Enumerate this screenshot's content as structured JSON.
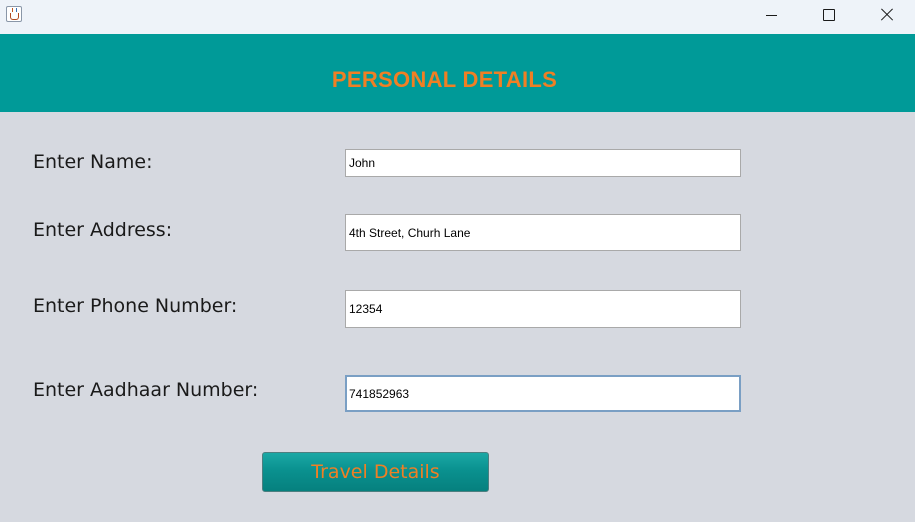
{
  "window": {
    "icon": "java-cup-icon"
  },
  "header": {
    "title": "PERSONAL DETAILS"
  },
  "form": {
    "name_label": "Enter Name:",
    "name_value": "John",
    "address_label": "Enter Address:",
    "address_value": "4th Street, Churh Lane",
    "phone_label": "Enter Phone Number:",
    "phone_value": "12354",
    "aadhaar_label": "Enter Aadhaar Number:",
    "aadhaar_value": "741852963"
  },
  "actions": {
    "travel_label": "Travel Details"
  },
  "colors": {
    "header_bg": "#009a98",
    "accent_text": "#f07f24",
    "form_bg": "#d6d9e0"
  }
}
